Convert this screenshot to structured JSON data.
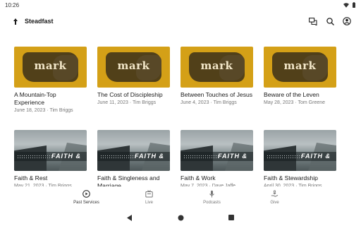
{
  "status_bar": {
    "time": "10:26"
  },
  "app_bar": {
    "title": "Steadfast"
  },
  "cards": [
    {
      "thumb": "mark",
      "thumb_text": "mark",
      "title": "A Mountain-Top Experience",
      "meta": "June 18, 2023 · Tim Briggs"
    },
    {
      "thumb": "mark",
      "thumb_text": "mark",
      "title": "The Cost of Discipleship",
      "meta": "June 11, 2023 · Tim Briggs"
    },
    {
      "thumb": "mark",
      "thumb_text": "mark",
      "title": "Between Touches of Jesus",
      "meta": "June 4, 2023 · Tim Briggs"
    },
    {
      "thumb": "mark",
      "thumb_text": "mark",
      "title": "Beware of the Leven",
      "meta": "May 28, 2023 · Tom Greene"
    },
    {
      "thumb": "faith",
      "thumb_text": "FAITH &",
      "title": "Faith & Rest",
      "meta": "May 21, 2023 · Tim Briggs"
    },
    {
      "thumb": "faith",
      "thumb_text": "FAITH &",
      "title": "Faith & Singleness and Marriage",
      "meta": ""
    },
    {
      "thumb": "faith",
      "thumb_text": "FAITH &",
      "title": "Faith & Work",
      "meta": "May 7, 2023 · Dave Jaffe"
    },
    {
      "thumb": "faith",
      "thumb_text": "FAITH &",
      "title": "Faith & Stewardship",
      "meta": "April 30, 2023 · Tim Briggs"
    }
  ],
  "bottom_nav": [
    {
      "label": "Past Services",
      "icon": "play-circle-icon",
      "active": true
    },
    {
      "label": "Live",
      "icon": "live-tv-icon",
      "active": false
    },
    {
      "label": "Podcasts",
      "icon": "microphone-icon",
      "active": false
    },
    {
      "label": "Give",
      "icon": "give-hand-icon",
      "active": false
    }
  ]
}
